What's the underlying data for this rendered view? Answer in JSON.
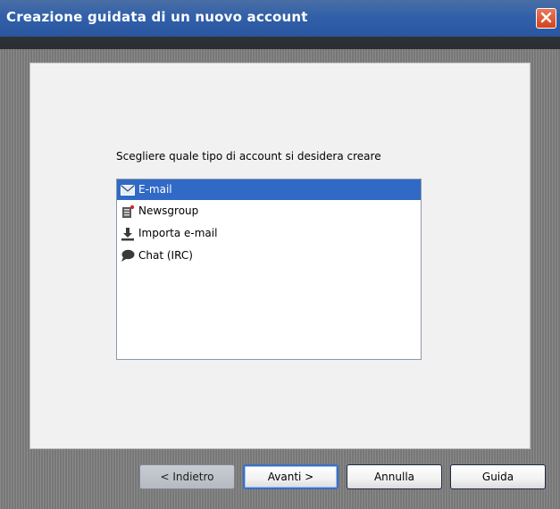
{
  "window": {
    "title": "Creazione guidata di un nuovo account"
  },
  "content": {
    "prompt": "Scegliere quale tipo di account si desidera creare",
    "account_types": [
      {
        "label": "E-mail",
        "icon": "envelope-icon",
        "selected": true
      },
      {
        "label": "Newsgroup",
        "icon": "newsgroup-icon",
        "selected": false
      },
      {
        "label": "Importa e-mail",
        "icon": "download-icon",
        "selected": false
      },
      {
        "label": "Chat (IRC)",
        "icon": "chat-bubble-icon",
        "selected": false
      }
    ]
  },
  "buttons": {
    "back": "< Indietro",
    "next": "Avanti >",
    "cancel": "Annulla",
    "help": "Guida"
  },
  "colors": {
    "selection": "#3169c6",
    "title_bar": "#3160a9",
    "close_button": "#d3431d"
  }
}
